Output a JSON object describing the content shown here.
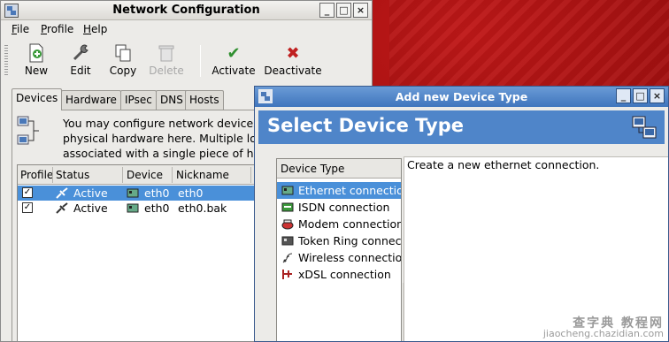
{
  "main_window": {
    "title": "Network Configuration",
    "controls": [
      "_",
      "□",
      "×"
    ],
    "menu": [
      "File",
      "Profile",
      "Help"
    ],
    "toolbar": [
      {
        "label": "New",
        "icon": "new-icon",
        "disabled": false
      },
      {
        "label": "Edit",
        "icon": "edit-icon",
        "disabled": false
      },
      {
        "label": "Copy",
        "icon": "copy-icon",
        "disabled": false
      },
      {
        "label": "Delete",
        "icon": "delete-icon",
        "disabled": true
      },
      {
        "label": "Activate",
        "icon": "check-icon",
        "disabled": false
      },
      {
        "label": "Deactivate",
        "icon": "x-icon",
        "disabled": false
      }
    ],
    "tabs": [
      "Devices",
      "Hardware",
      "IPsec",
      "DNS",
      "Hosts"
    ],
    "active_tab": "Devices",
    "info_lines": [
      "You may configure network devices a",
      "physical hardware here.  Multiple logi",
      "associated with a single piece of hard"
    ],
    "table": {
      "columns": [
        "Profile",
        "Status",
        "Device",
        "Nickname",
        "T"
      ],
      "rows": [
        {
          "profile_checked": true,
          "status": "Active",
          "device": "eth0",
          "nickname": "eth0",
          "type": "E",
          "selected": true
        },
        {
          "profile_checked": true,
          "status": "Active",
          "device": "eth0",
          "nickname": "eth0.bak",
          "type": "E",
          "selected": false
        }
      ]
    }
  },
  "dialog": {
    "title": "Add new Device Type",
    "controls": [
      "_",
      "□",
      "×"
    ],
    "banner": "Select Device Type",
    "list_header": "Device Type",
    "device_types": [
      {
        "label": "Ethernet connection",
        "icon": "ethernet-card-icon",
        "selected": true
      },
      {
        "label": "ISDN connection",
        "icon": "isdn-card-icon",
        "selected": false
      },
      {
        "label": "Modem connection",
        "icon": "modem-icon",
        "selected": false
      },
      {
        "label": "Token Ring connection",
        "icon": "token-ring-icon",
        "selected": false
      },
      {
        "label": "Wireless connection",
        "icon": "wireless-icon",
        "selected": false
      },
      {
        "label": "xDSL connection",
        "icon": "xdsl-icon",
        "selected": false
      }
    ],
    "description": "Create a new ethernet connection."
  },
  "watermark": {
    "line1": "查字典 教程网",
    "line2": "jiaocheng.chazidian.com"
  },
  "colors": {
    "selection": "#4a90d9",
    "banner": "#4f85c9",
    "desktop": "#a01010",
    "titlebar_active": "#3f75bd"
  }
}
